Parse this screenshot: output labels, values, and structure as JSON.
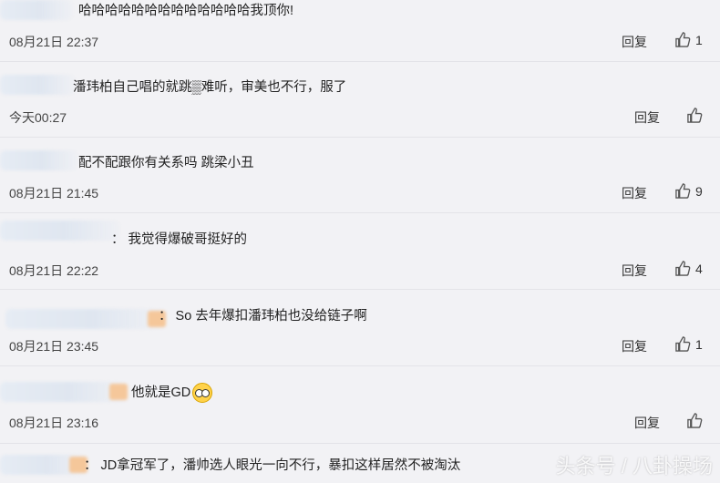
{
  "comments": [
    {
      "text": "哈哈哈哈哈哈哈哈哈哈哈哈哈我顶你!",
      "time": "08月21日 22:37",
      "reply": "回复",
      "likes": "1"
    },
    {
      "text": "潘玮柏自己唱的就跳▒难听，审美也不行，服了",
      "time": "今天00:27",
      "reply": "回复",
      "likes": ""
    },
    {
      "text": "配不配跟你有关系吗 跳梁小丑",
      "time": "08月21日 21:45",
      "reply": "回复",
      "likes": "9"
    },
    {
      "text": "：  我觉得爆破哥挺好的",
      "time": "08月21日 22:22",
      "reply": "回复",
      "likes": "4"
    },
    {
      "text": "：  So 去年爆扣潘玮柏也没给链子啊",
      "time": "08月21日 23:45",
      "reply": "回复",
      "likes": "1"
    },
    {
      "text": "他就是GD",
      "time": "08月21日 23:16",
      "reply": "回复",
      "likes": ""
    },
    {
      "text": "：  JD拿冠军了，潘帅选人眼光一向不行，暴扣这样居然不被淘汰",
      "time": "",
      "reply": "",
      "likes": ""
    }
  ],
  "watermark": "头条号 / 八卦操场"
}
